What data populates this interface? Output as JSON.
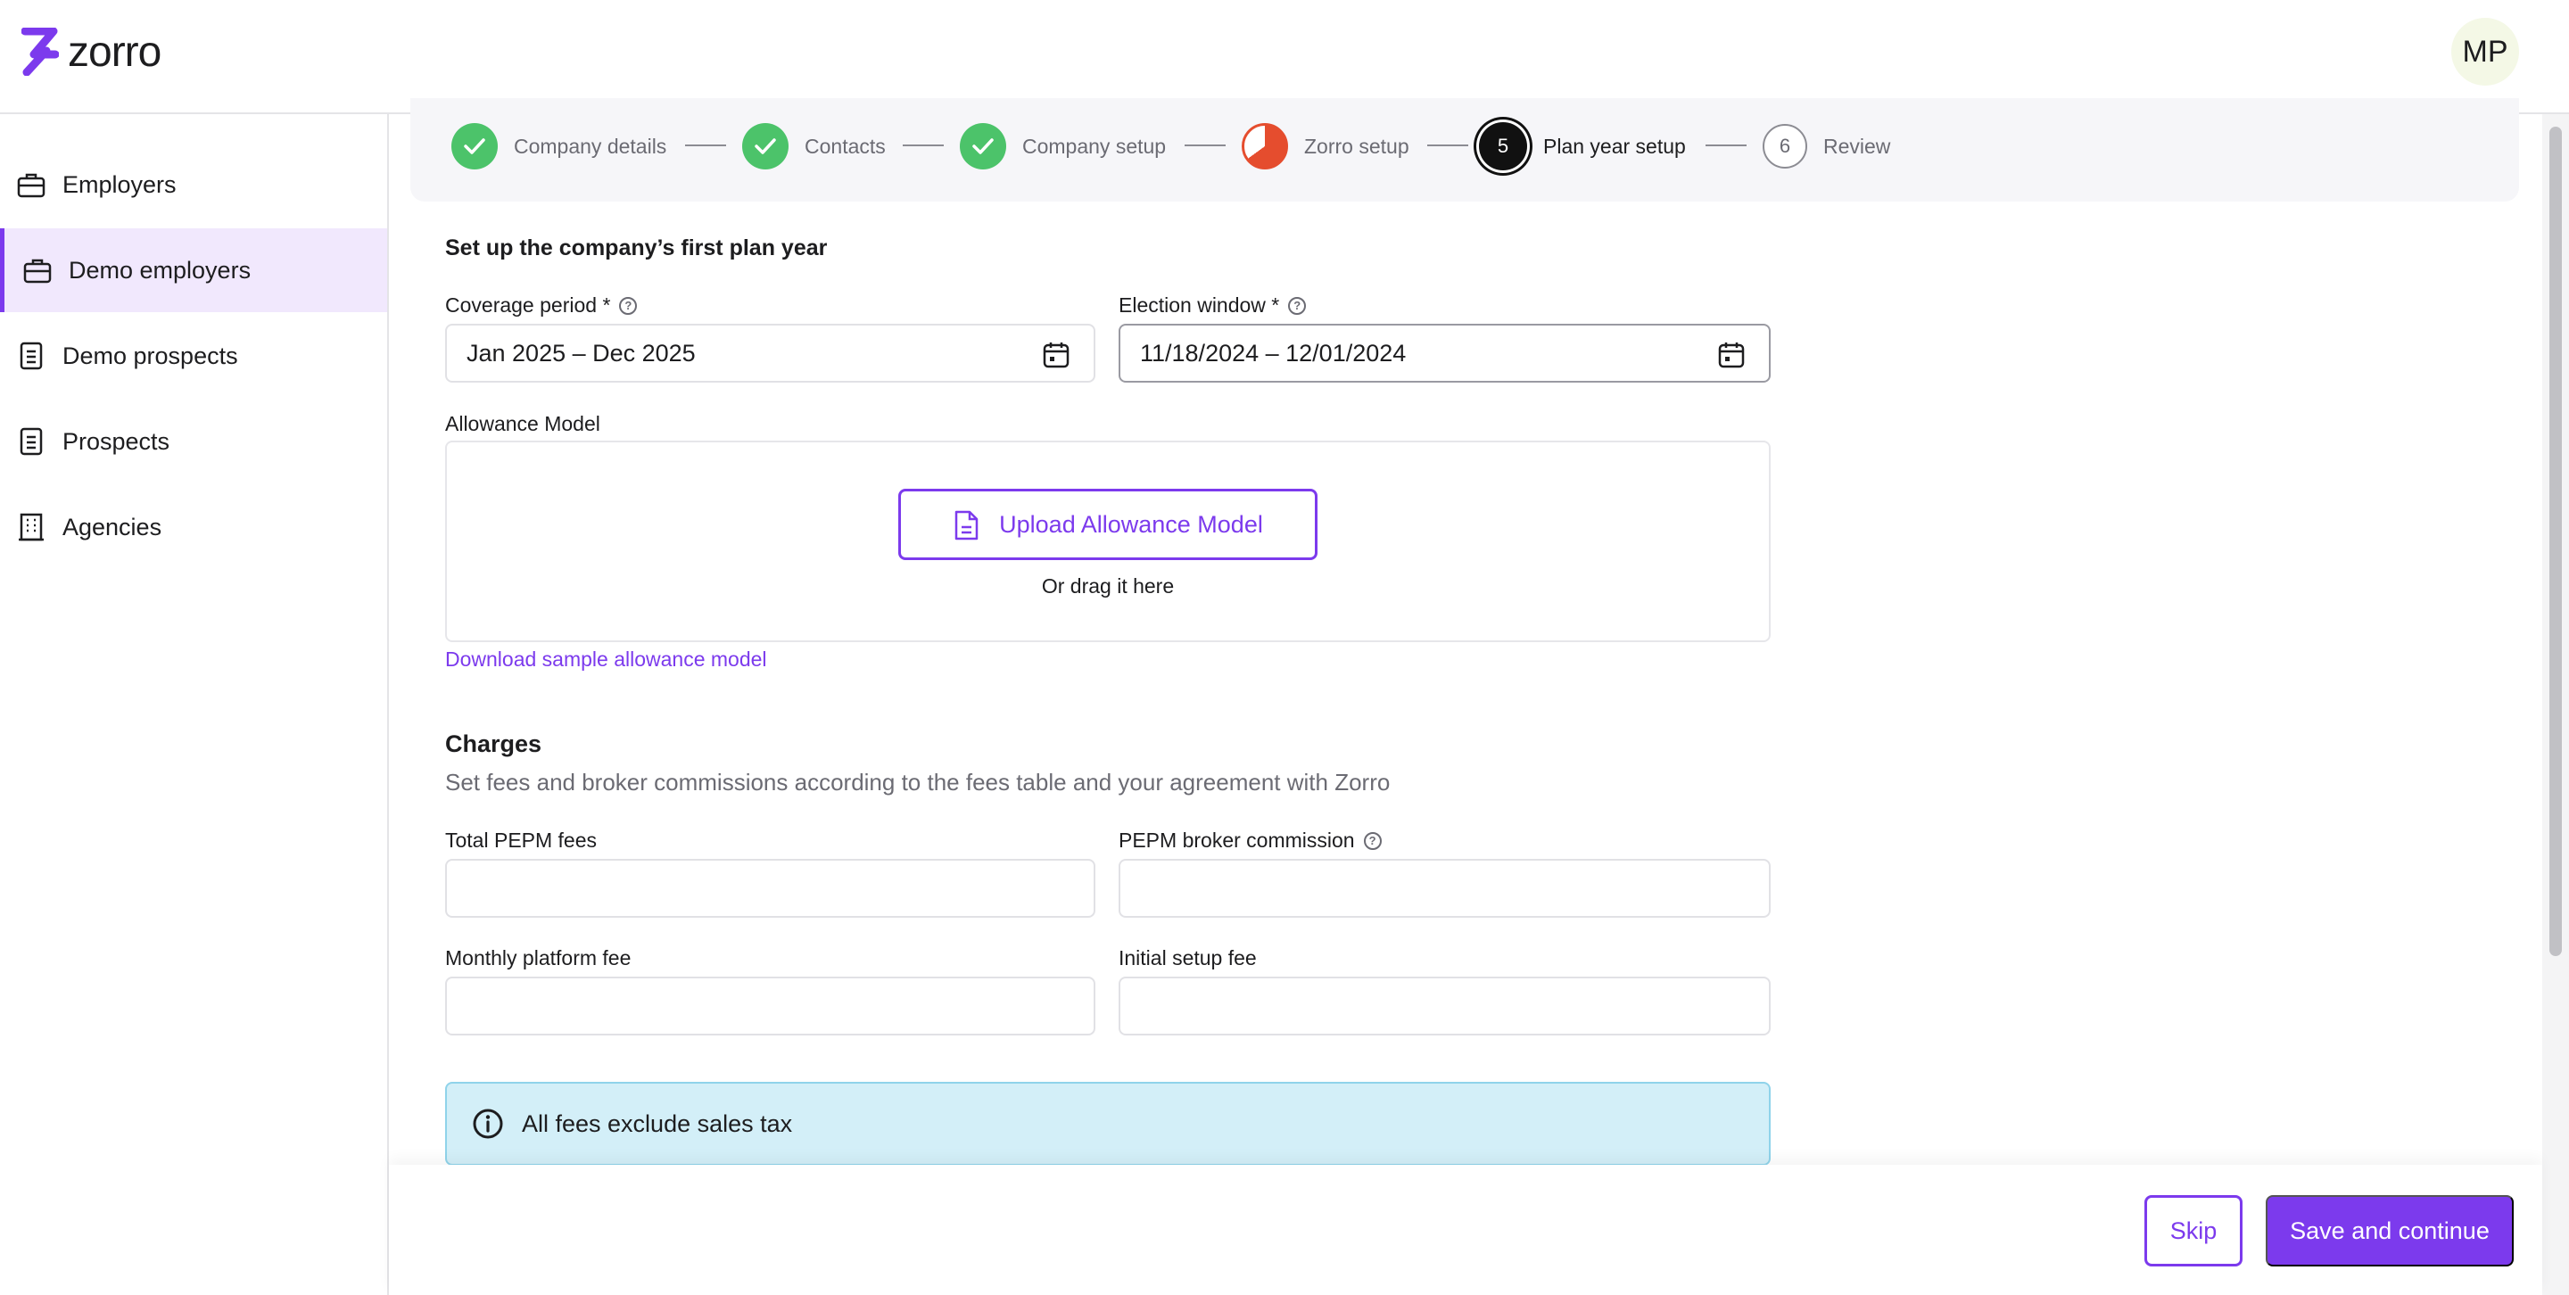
{
  "app": {
    "logo_text": "zorro",
    "avatar_initials": "MP"
  },
  "colors": {
    "accent": "#7c3aed",
    "success": "#4cc36a",
    "warning": "#e54d2e",
    "info_bg": "#d3eff8"
  },
  "sidebar": {
    "items": [
      {
        "label": "Employers",
        "icon": "briefcase-icon",
        "active": false
      },
      {
        "label": "Demo employers",
        "icon": "briefcase-icon",
        "active": true
      },
      {
        "label": "Demo prospects",
        "icon": "document-icon",
        "active": false
      },
      {
        "label": "Prospects",
        "icon": "document-icon",
        "active": false
      },
      {
        "label": "Agencies",
        "icon": "building-icon",
        "active": false
      }
    ]
  },
  "stepper": {
    "steps": [
      {
        "label": "Company details",
        "status": "done",
        "number": ""
      },
      {
        "label": "Contacts",
        "status": "done",
        "number": ""
      },
      {
        "label": "Company setup",
        "status": "done",
        "number": ""
      },
      {
        "label": "Zorro setup",
        "status": "partial",
        "number": ""
      },
      {
        "label": "Plan year setup",
        "status": "current",
        "number": "5"
      },
      {
        "label": "Review",
        "status": "todo",
        "number": "6"
      }
    ]
  },
  "form": {
    "title": "Set up the company’s first plan year",
    "coverage_period": {
      "label": "Coverage period *",
      "value": "Jan 2025 – Dec 2025"
    },
    "election_window": {
      "label": "Election window *",
      "value": "11/18/2024 – 12/01/2024"
    },
    "allowance_model": {
      "label": "Allowance Model",
      "upload_label": "Upload Allowance Model",
      "drag_text": "Or drag it here",
      "sample_link": "Download sample allowance model"
    }
  },
  "charges": {
    "title": "Charges",
    "subtitle": "Set fees and broker commissions according to the fees table and your agreement with Zorro",
    "total_pepm_fees": {
      "label": "Total PEPM fees",
      "value": ""
    },
    "pepm_broker_commission": {
      "label": "PEPM broker commission",
      "value": ""
    },
    "monthly_platform_fee": {
      "label": "Monthly platform fee",
      "value": ""
    },
    "initial_setup_fee": {
      "label": "Initial setup fee",
      "value": ""
    },
    "info_text": "All fees exclude sales tax"
  },
  "footer": {
    "skip_label": "Skip",
    "save_label": "Save and continue"
  }
}
